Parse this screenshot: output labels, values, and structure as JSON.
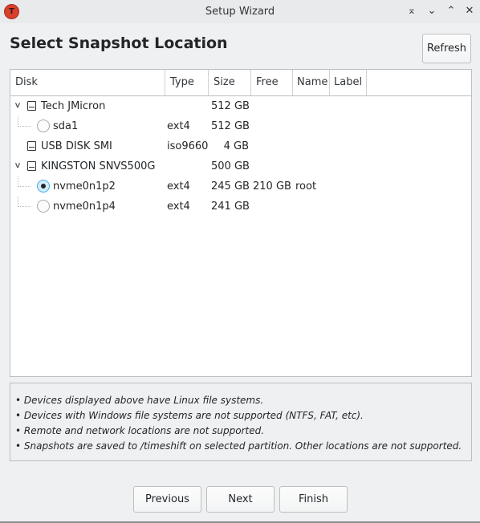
{
  "window": {
    "title": "Setup Wizard",
    "controls": [
      "keep-above",
      "minimize",
      "maximize",
      "close"
    ]
  },
  "page": {
    "title": "Select Snapshot Location",
    "refresh_label": "Refresh"
  },
  "table": {
    "columns": [
      "Disk",
      "Type",
      "Size",
      "Free",
      "Name",
      "Label"
    ],
    "rows": [
      {
        "kind": "disk",
        "expanded": true,
        "disk": "Tech JMicron",
        "type": "",
        "size": "512 GB",
        "free": "",
        "name": "",
        "label": ""
      },
      {
        "kind": "partition",
        "selected": false,
        "disk": "sda1",
        "type": "ext4",
        "size": "512 GB",
        "free": "",
        "name": "",
        "label": ""
      },
      {
        "kind": "disk",
        "expanded": null,
        "disk": "USB DISK SMI",
        "type": "iso9660",
        "size": "4 GB",
        "free": "",
        "name": "",
        "label": ""
      },
      {
        "kind": "disk",
        "expanded": true,
        "disk": "KINGSTON SNVS500G",
        "type": "",
        "size": "500 GB",
        "free": "",
        "name": "",
        "label": ""
      },
      {
        "kind": "partition",
        "selected": true,
        "disk": "nvme0n1p2",
        "type": "ext4",
        "size": "245 GB",
        "free": "210 GB",
        "name": "root",
        "label": ""
      },
      {
        "kind": "partition",
        "selected": false,
        "disk": "nvme0n1p4",
        "type": "ext4",
        "size": "241 GB",
        "free": "",
        "name": "",
        "label": ""
      }
    ]
  },
  "notes": [
    "• Devices displayed above have Linux file systems.",
    "• Devices with Windows file systems are not supported (NTFS, FAT, etc).",
    "• Remote and network locations are not supported.",
    "• Snapshots are saved to /timeshift on selected partition. Other locations are not supported."
  ],
  "buttons": {
    "previous": "Previous",
    "next": "Next",
    "finish": "Finish"
  },
  "icons": {
    "app": "timeshift-app-icon",
    "expander": "chevron-down-icon",
    "drive": "drive-icon",
    "radio": "radio-button"
  },
  "colors": {
    "accent": "#3daee9",
    "app_icon": "#d8402b",
    "background": "#eff0f1"
  }
}
